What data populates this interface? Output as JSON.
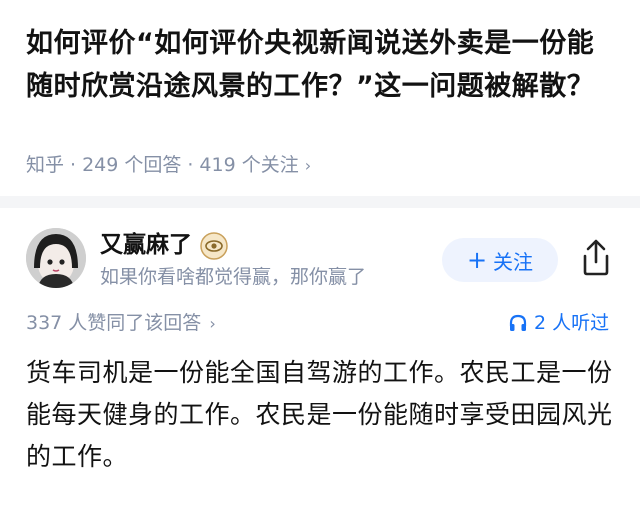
{
  "question": {
    "title": "如何评价“如何评价央视新闻说送外卖是一份能随时欣赏沿途风景的工作？”这一问题被解散？",
    "source": "知乎",
    "answers_count": "249 个回答",
    "followers_count": "419 个关注",
    "chevron": "›"
  },
  "author": {
    "name": "又赢麻了",
    "bio": "如果你看啥都觉得赢，那你赢了",
    "follow_label": "关注",
    "follow_plus": "+",
    "badge_icon": "eye-badge-icon",
    "share_icon": "share-icon"
  },
  "stats": {
    "upvote_summary": "337 人赞同了该回答",
    "chevron": "›",
    "listen_label": "2 人听过",
    "listen_icon": "headphones-icon"
  },
  "answer": {
    "text": "货车司机是一份能全国自驾游的工作。农民工是一份能每天健身的工作。农民是一份能随时享受田园风光的工作。"
  },
  "colors": {
    "accent": "#1772f6",
    "meta": "#8590a6",
    "follow_bg": "#eef3fe",
    "divider": "#f4f5f7"
  }
}
